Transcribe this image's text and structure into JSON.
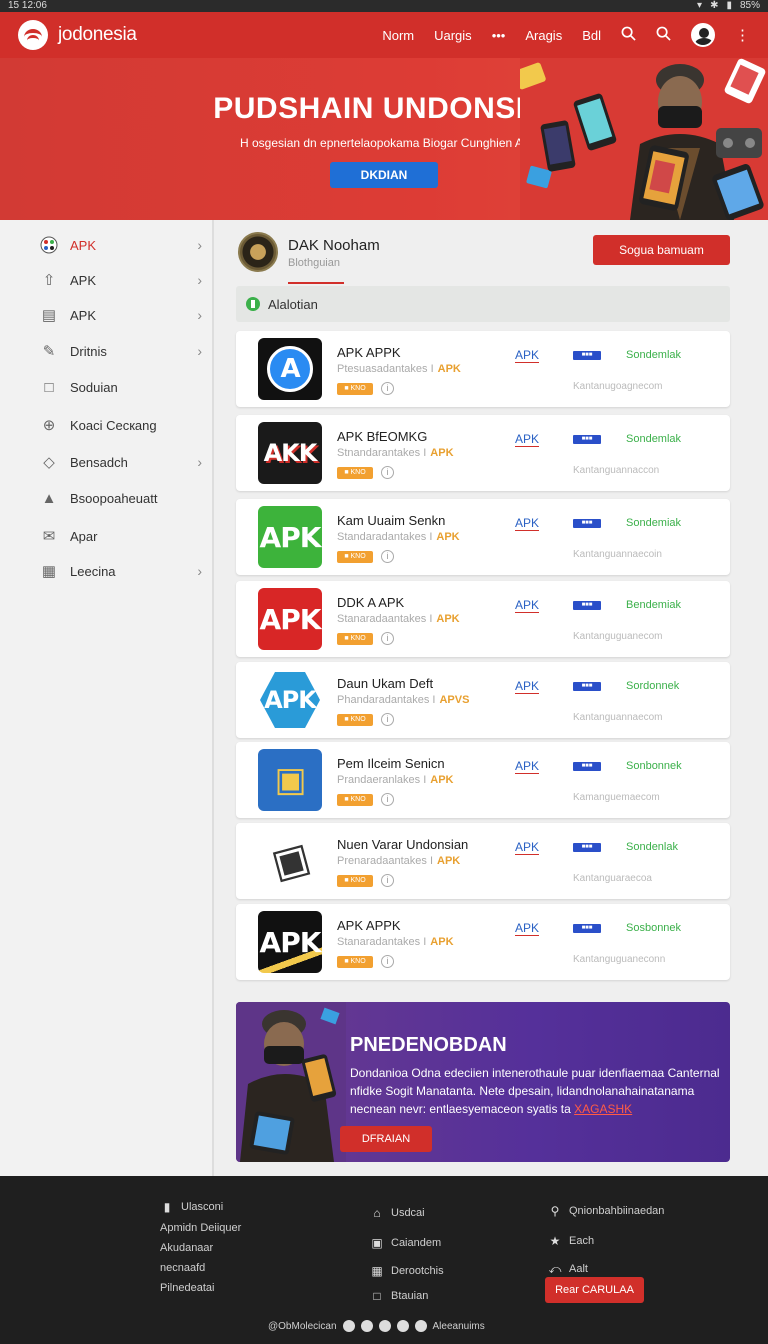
{
  "statusbar": {
    "time": "15 12:06",
    "battery": "85%"
  },
  "header": {
    "brand": "jodonesia",
    "nav": [
      "Norm",
      "Uargis",
      "•••",
      "Aragis",
      "Bdl"
    ],
    "icons": [
      "search-icon",
      "search-icon",
      "avatar",
      "more-icon"
    ]
  },
  "hero": {
    "title": "PUDSHAIN UNDONSIA",
    "subtitle": "H osgesian dn epnertelaopokama Biogar Cunghien APPK",
    "button": "DKDIAN"
  },
  "sidebar": {
    "items": [
      {
        "label": "APK",
        "icon": "palette-icon",
        "chevron": true,
        "active": true
      },
      {
        "label": "APK",
        "icon": "share-icon",
        "chevron": true
      },
      {
        "label": "APK",
        "icon": "document-icon",
        "chevron": true
      },
      {
        "label": "Dritnis",
        "icon": "brush-icon",
        "chevron": true
      },
      {
        "label": "Soduian",
        "icon": "chart-icon",
        "chevron": false
      },
      {
        "label": "Koaci Cecкang",
        "icon": "globe-icon",
        "chevron": false
      },
      {
        "label": "Bensadch",
        "icon": "tag-icon",
        "chevron": true
      },
      {
        "label": "Bsoopoahеuatt",
        "icon": "store-icon",
        "chevron": false
      },
      {
        "label": "Apar",
        "icon": "mail-icon",
        "chevron": false
      },
      {
        "label": "Leecina",
        "icon": "gift-icon",
        "chevron": true
      }
    ]
  },
  "developer": {
    "name": "DAK Nooham",
    "subtitle": "Blothguian",
    "follow_button": "Sogua bamuam"
  },
  "section": {
    "title": "Alalotian"
  },
  "apps": [
    {
      "name": "APK APPK",
      "desc": "Ptesuasadantakes I",
      "apk": "APK",
      "badge": "■ KNO",
      "link": "APK",
      "tag": "■■■",
      "status": "Sondemlak",
      "meta": "Kantanugoagnecom",
      "icon_text": "A",
      "icon_bg": "#111111",
      "icon_style": "appstore"
    },
    {
      "name": "APK BfEOMKG",
      "desc": "Stnandarantakes I",
      "apk": "APK",
      "badge": "■ KNO",
      "link": "APK",
      "tag": "■■■",
      "status": "Sondemlak",
      "meta": "Kantanguannaccon",
      "icon_text": "AKK",
      "icon_bg": "#1a1a1a",
      "icon_style": "bolt"
    },
    {
      "name": "Kam Uuaim Senkn",
      "desc": "Standaradantakes I",
      "apk": "APK",
      "badge": "■ KNO",
      "link": "APK",
      "tag": "■■■",
      "status": "Sondemiak",
      "meta": "Kantanguannaecoin",
      "icon_text": "APK",
      "icon_bg": "#3db33b",
      "icon_style": "plain"
    },
    {
      "name": "DDK A APK",
      "desc": "Stanaradaantakes I",
      "apk": "APK",
      "badge": "■ KNO",
      "link": "APK",
      "tag": "■■■",
      "status": "Bendemiak",
      "meta": "Kantanguguanecom",
      "icon_text": "APK",
      "icon_bg": "#d82626",
      "icon_style": "plain"
    },
    {
      "name": "Daun Ukam Deft",
      "desc": "Phandaradantakes I",
      "apk": "APVS",
      "badge": "■ KNO",
      "link": "APK",
      "tag": "■■■",
      "status": "Sordonnek",
      "meta": "Kantanguannaecom",
      "icon_text": "APK",
      "icon_bg": "#2a9bd8",
      "icon_style": "hex"
    },
    {
      "name": "Pem Ilceim Senicn",
      "desc": "Prandaeranlakes I",
      "apk": "APK",
      "badge": "■ KNO",
      "link": "APK",
      "tag": "■■■",
      "status": "Sonbonnek",
      "meta": "Kamanguemaecom",
      "icon_text": "▣",
      "icon_bg": "#2b6fc4",
      "icon_style": "phone"
    },
    {
      "name": "Nuen Varar Undonsian",
      "desc": "Prenaradaantakes I",
      "apk": "APK",
      "badge": "■ KNO",
      "link": "APK",
      "tag": "■■■",
      "status": "Sondenlak",
      "meta": "Kantanguaraecoa",
      "icon_text": "▣",
      "icon_bg": "#ffffff",
      "icon_style": "tablet"
    },
    {
      "name": "APK APPK",
      "desc": "Stanaradantakes I",
      "apk": "APK",
      "badge": "■ KNO",
      "link": "APK",
      "tag": "■■■",
      "status": "Sosbonnek",
      "meta": "Kantanguguaneconn",
      "icon_text": "APK",
      "icon_bg": "#111111",
      "icon_style": "stripe"
    }
  ],
  "promo": {
    "title": "PNEDENOBDAN",
    "body": "Dondanioa Odna edeciien intenerothaule puar idenfiaemaa Canternal nfidke Sogit Manatanta. Nete dpesain, lidandnolanahainatanama necnean nevr: entlaesyemaceon syatis ta",
    "highlight": "XAGASHK",
    "button": "DFRAIAN"
  },
  "footer": {
    "col1": {
      "heading": "Ulasconi",
      "lines": [
        "Apmidn Deiiquer",
        "Akudanaar",
        "necnaafd",
        "Pilnedeatai"
      ]
    },
    "col2": [
      {
        "icon": "home-icon",
        "label": "Usdcai"
      },
      {
        "icon": "calendar-icon",
        "label": "Caiandem"
      },
      {
        "icon": "grid-icon",
        "label": "Derootchis"
      },
      {
        "icon": "doc-icon",
        "label": "Btauian"
      }
    ],
    "col3": [
      {
        "icon": "pin-icon",
        "label": "Qnionbahbiinaedan"
      },
      {
        "icon": "star-icon",
        "label": "Each"
      },
      {
        "icon": "share-icon",
        "label": "Aalt"
      }
    ],
    "button": "Rear CARULAA",
    "bottom_left": "@ObMolecican",
    "bottom_right": "Aleeanuims"
  },
  "colors": {
    "brand_red": "#d12f2a",
    "link_blue": "#2a61c4",
    "status_green": "#3bb04a",
    "promo_purple": "#55309a"
  }
}
